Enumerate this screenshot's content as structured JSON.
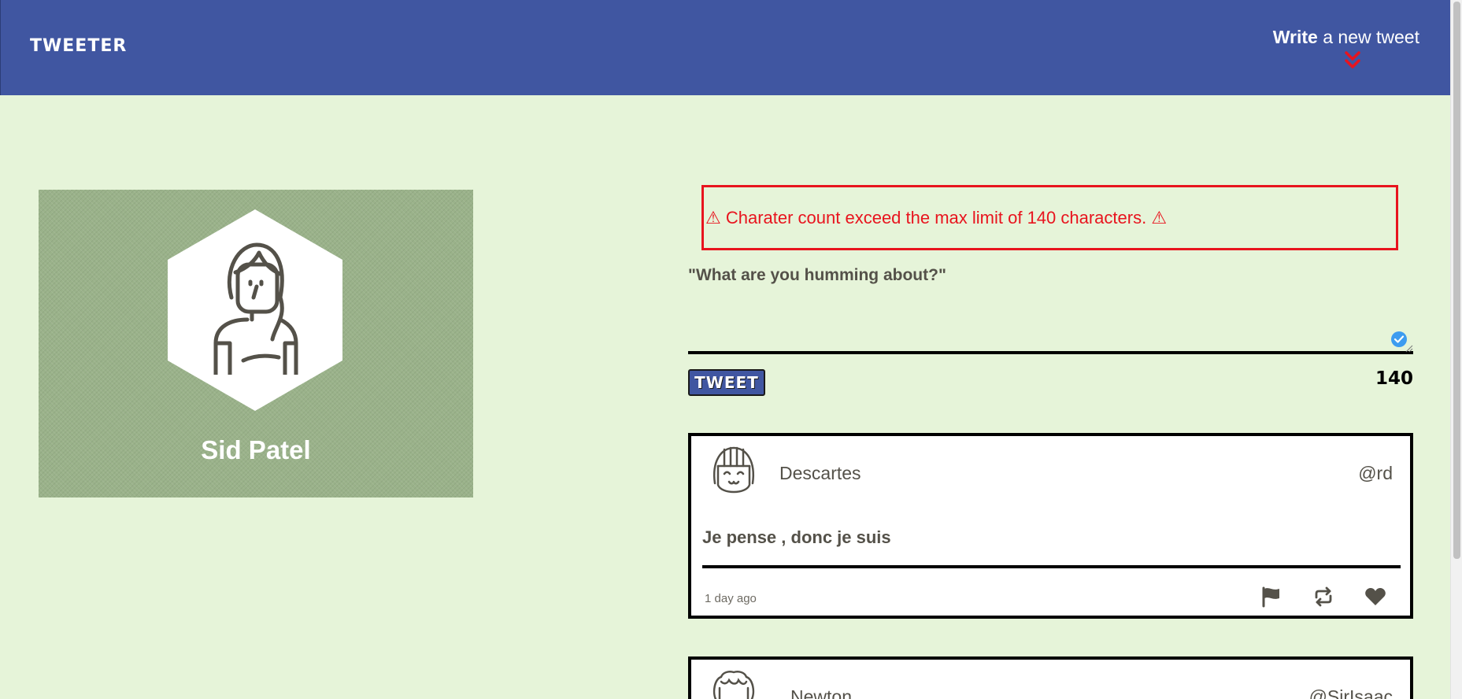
{
  "header": {
    "brand": "TWEETER",
    "compose_bold": "Write",
    "compose_light": " a new tweet"
  },
  "profile": {
    "name": "Sid Patel"
  },
  "compose": {
    "error_message": "⚠ Charater count exceed the max limit of 140 characters. ⚠",
    "prompt": "\"What are you humming about?\"",
    "textarea_value": "",
    "button_label": "TWEET",
    "counter": "140"
  },
  "tweets": [
    {
      "name": "Descartes",
      "handle": "@rd",
      "body": "Je pense , donc je suis",
      "time": "1 day ago"
    },
    {
      "name": "Newton",
      "handle": "@SirIsaac"
    }
  ],
  "colors": {
    "header_bg": "#4056a1",
    "page_bg": "#e6f4d9",
    "profile_bg": "#9ab28a",
    "error": "#e8141e",
    "text": "#545149"
  },
  "icons": {
    "compose_chevron": "double-chevron-down-icon",
    "validation": "check-circle-icon",
    "actions": [
      "flag-icon",
      "retweet-icon",
      "heart-icon"
    ]
  }
}
